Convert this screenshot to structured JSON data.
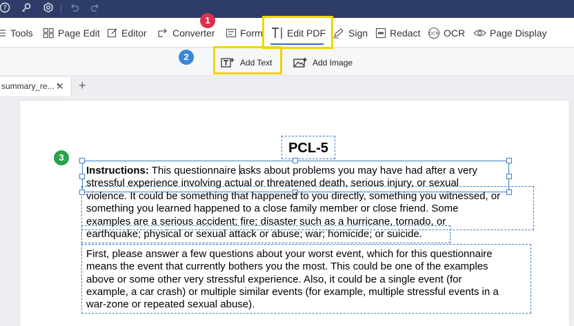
{
  "ribbon": {
    "tools": "Tools",
    "page_edit": "Page Edit",
    "editor": "Editor",
    "converter": "Converter",
    "form": "Form",
    "edit_pdf": "Edit PDF",
    "sign": "Sign",
    "redact": "Redact",
    "ocr": "OCR",
    "page_display": "Page Display"
  },
  "subtoolbar": {
    "add_text": "Add Text",
    "add_image": "Add Image"
  },
  "tab": {
    "label": "summary_re... *"
  },
  "badges": [
    "1",
    "2",
    "3"
  ],
  "document": {
    "title": "PCL-5",
    "instructions_label": "Instructions:",
    "instr_line1_a": "This questionnaire",
    "instr_line1_b": "asks about problems you may have had after a very",
    "instr_line2": "stressful experience involving actual or threatened death, serious injury, or sexual",
    "para2_line1": "violence. It could be something that happened to you directly, something you witnessed, or",
    "para2_line2": "something you learned happened to a close family member or close friend. Some",
    "para2_line3": "examples are a serious accident; fire; disaster such as a hurricane, tornado, or",
    "para3_line1": "earthquake; physical or sexual attack or abuse; war; homicide; or suicide.",
    "para4_line1": "First, please answer a few questions about your worst event, which for this questionnaire",
    "para4_line2": "means the event that currently bothers you the most. This could be one of the examples",
    "para4_line3": "above or some other very stressful experience. Also, it could be a single event (for",
    "para4_line4": "example, a car crash) or multiple similar events (for example, multiple stressful events in a",
    "para4_line5": "war-zone or repeated sexual abuse)."
  },
  "colors": {
    "titlebar": "#2e3d68",
    "highlight": "#f2d400",
    "badge_red": "#d9304f",
    "badge_blue": "#3b86d6",
    "badge_green": "#2ba24c",
    "selection": "#3d7ac8"
  }
}
